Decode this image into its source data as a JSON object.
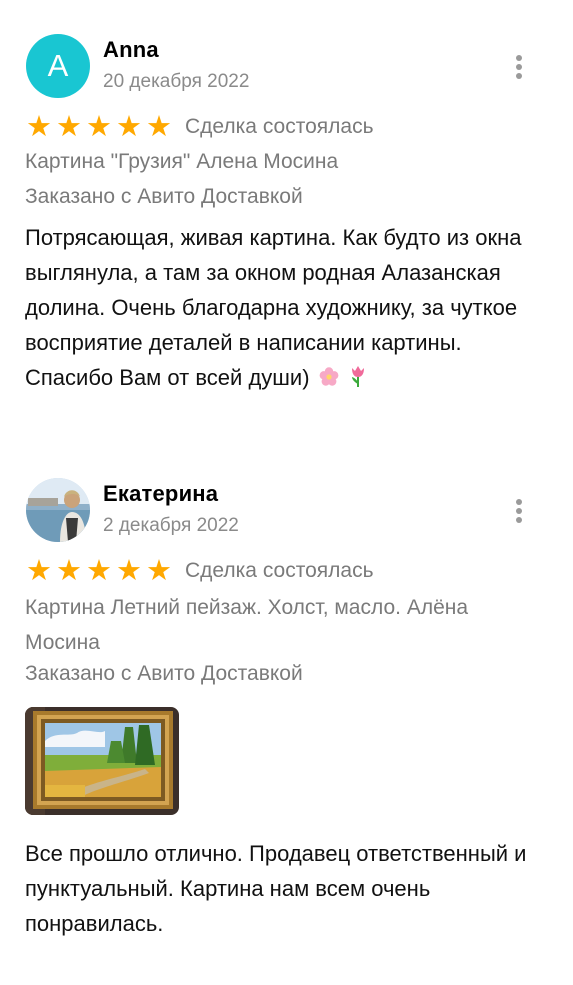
{
  "colors": {
    "star": "#ffa800",
    "avatar_bg": "#19c6d2",
    "muted_text": "#7a7a7a"
  },
  "reviews": [
    {
      "avatar_letter": "A",
      "author": "Anna",
      "date": "20 декабря 2022",
      "rating": 5,
      "deal_status": "Сделка состоялась",
      "product": "Картина \"Грузия\" Алена Мосина",
      "delivery": "Заказано с Авито Доставкой",
      "text": "Потрясающая, живая картина. Как будто из окна выглянула, а там за окном  родная Алазанская долина. Очень благодарна художнику, за чуткое восприятие деталей в написании картины. Спасибо Вам от всей души)",
      "emojis": [
        "cherry-blossom-icon",
        "tulip-icon"
      ]
    },
    {
      "author": "Екатерина",
      "date": "2 декабря 2022",
      "rating": 5,
      "deal_status": "Сделка состоялась",
      "product": "Картина Летний пейзаж. Холст, масло. Алёна Мосина",
      "delivery": "Заказано с Авито Доставкой",
      "text": "Все прошло отлично. Продавец ответственный и пунктуальный. Картина нам всем очень понравилась."
    }
  ],
  "icons": {
    "star": "★",
    "more": "more-vertical-icon"
  }
}
